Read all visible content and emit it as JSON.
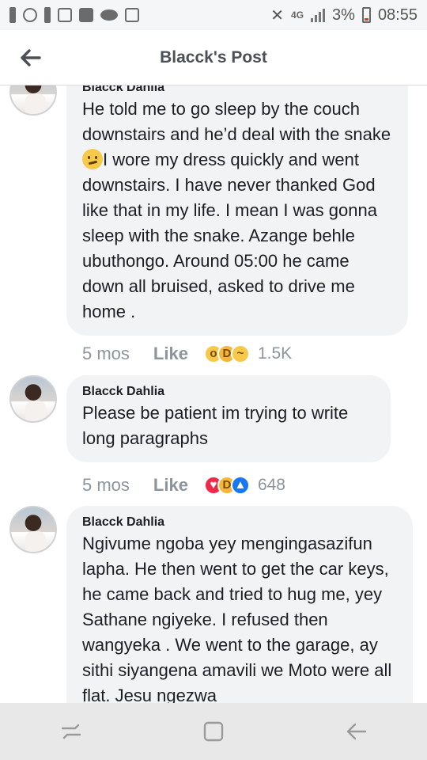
{
  "status_bar": {
    "network": "4G",
    "battery": "3%",
    "time": "08:55"
  },
  "header": {
    "title": "Blacck's Post"
  },
  "comments": [
    {
      "author": "Blacck Dahlia",
      "text_before_emoji": "He told me to go sleep by the couch downstairs and he’d deal with the snake",
      "text_after_emoji": "I wore my dress quickly and went downstairs. I have never thanked God like that in my life. I mean I was gonna sleep with the snake. Azange behle ubuthongo. Around 05:00 he came down all bruised, asked to drive me home .",
      "time": "5 mos",
      "like_label": "Like",
      "reactions": [
        "wow",
        "haha",
        "sad"
      ],
      "reaction_count": "1.5K"
    },
    {
      "author": "Blacck Dahlia",
      "text": "Please be patient im trying to write long paragraphs",
      "time": "5 mos",
      "like_label": "Like",
      "reactions": [
        "love",
        "haha",
        "like"
      ],
      "reaction_count": "648"
    },
    {
      "author": "Blacck Dahlia",
      "text": "Ngivume ngoba yey mengingasazifun lapha. He then went to get the car keys, he came back and tried to hug me, yey Sathane ngiyeke. I refused then wangyeka . We went to the garage, ay sithi siyangena amavili we Moto were all flat. Jesu ngezwa"
    }
  ],
  "colors": {
    "bubble": "#f2f3f5",
    "meta_text": "#8d949e",
    "header_title": "#4b4f56"
  }
}
